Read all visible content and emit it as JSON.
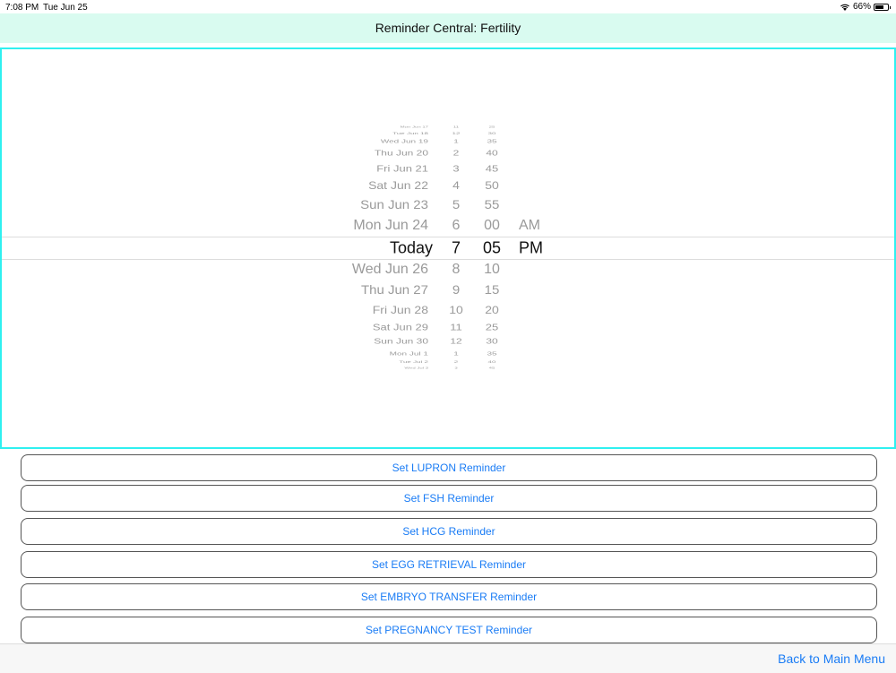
{
  "status_bar": {
    "time": "7:08 PM",
    "date": "Tue Jun 25",
    "battery": "66%",
    "battery_level": 0.66
  },
  "nav": {
    "title": "Reminder Central: Fertility"
  },
  "picker": {
    "rows": [
      {
        "date": "Mon Jun 17",
        "hour": "11",
        "minute": "25",
        "ampm": ""
      },
      {
        "date": "Tue Jun 18",
        "hour": "12",
        "minute": "30",
        "ampm": ""
      },
      {
        "date": "Wed Jun 19",
        "hour": "1",
        "minute": "35",
        "ampm": ""
      },
      {
        "date": "Thu Jun 20",
        "hour": "2",
        "minute": "40",
        "ampm": ""
      },
      {
        "date": "Fri Jun 21",
        "hour": "3",
        "minute": "45",
        "ampm": ""
      },
      {
        "date": "Sat Jun 22",
        "hour": "4",
        "minute": "50",
        "ampm": ""
      },
      {
        "date": "Sun Jun 23",
        "hour": "5",
        "minute": "55",
        "ampm": ""
      },
      {
        "date": "Mon Jun 24",
        "hour": "6",
        "minute": "00",
        "ampm": "AM"
      },
      {
        "date": "Today",
        "hour": "7",
        "minute": "05",
        "ampm": "PM"
      },
      {
        "date": "Wed Jun 26",
        "hour": "8",
        "minute": "10",
        "ampm": ""
      },
      {
        "date": "Thu Jun 27",
        "hour": "9",
        "minute": "15",
        "ampm": ""
      },
      {
        "date": "Fri Jun 28",
        "hour": "10",
        "minute": "20",
        "ampm": ""
      },
      {
        "date": "Sat Jun 29",
        "hour": "11",
        "minute": "25",
        "ampm": ""
      },
      {
        "date": "Sun Jun 30",
        "hour": "12",
        "minute": "30",
        "ampm": ""
      },
      {
        "date": "Mon Jul 1",
        "hour": "1",
        "minute": "35",
        "ampm": ""
      },
      {
        "date": "Tue Jul 2",
        "hour": "2",
        "minute": "40",
        "ampm": ""
      },
      {
        "date": "Wed Jul 3",
        "hour": "3",
        "minute": "45",
        "ampm": ""
      }
    ],
    "selected_index": 8
  },
  "buttons": [
    {
      "label": "Set LUPRON Reminder"
    },
    {
      "label": "Set FSH Reminder"
    },
    {
      "label": "Set HCG Reminder"
    },
    {
      "label": "Set EGG RETRIEVAL Reminder"
    },
    {
      "label": "Set EMBRYO TRANSFER Reminder"
    },
    {
      "label": "Set PREGNANCY TEST Reminder"
    }
  ],
  "toolbar": {
    "back_label": "Back to Main Menu"
  }
}
